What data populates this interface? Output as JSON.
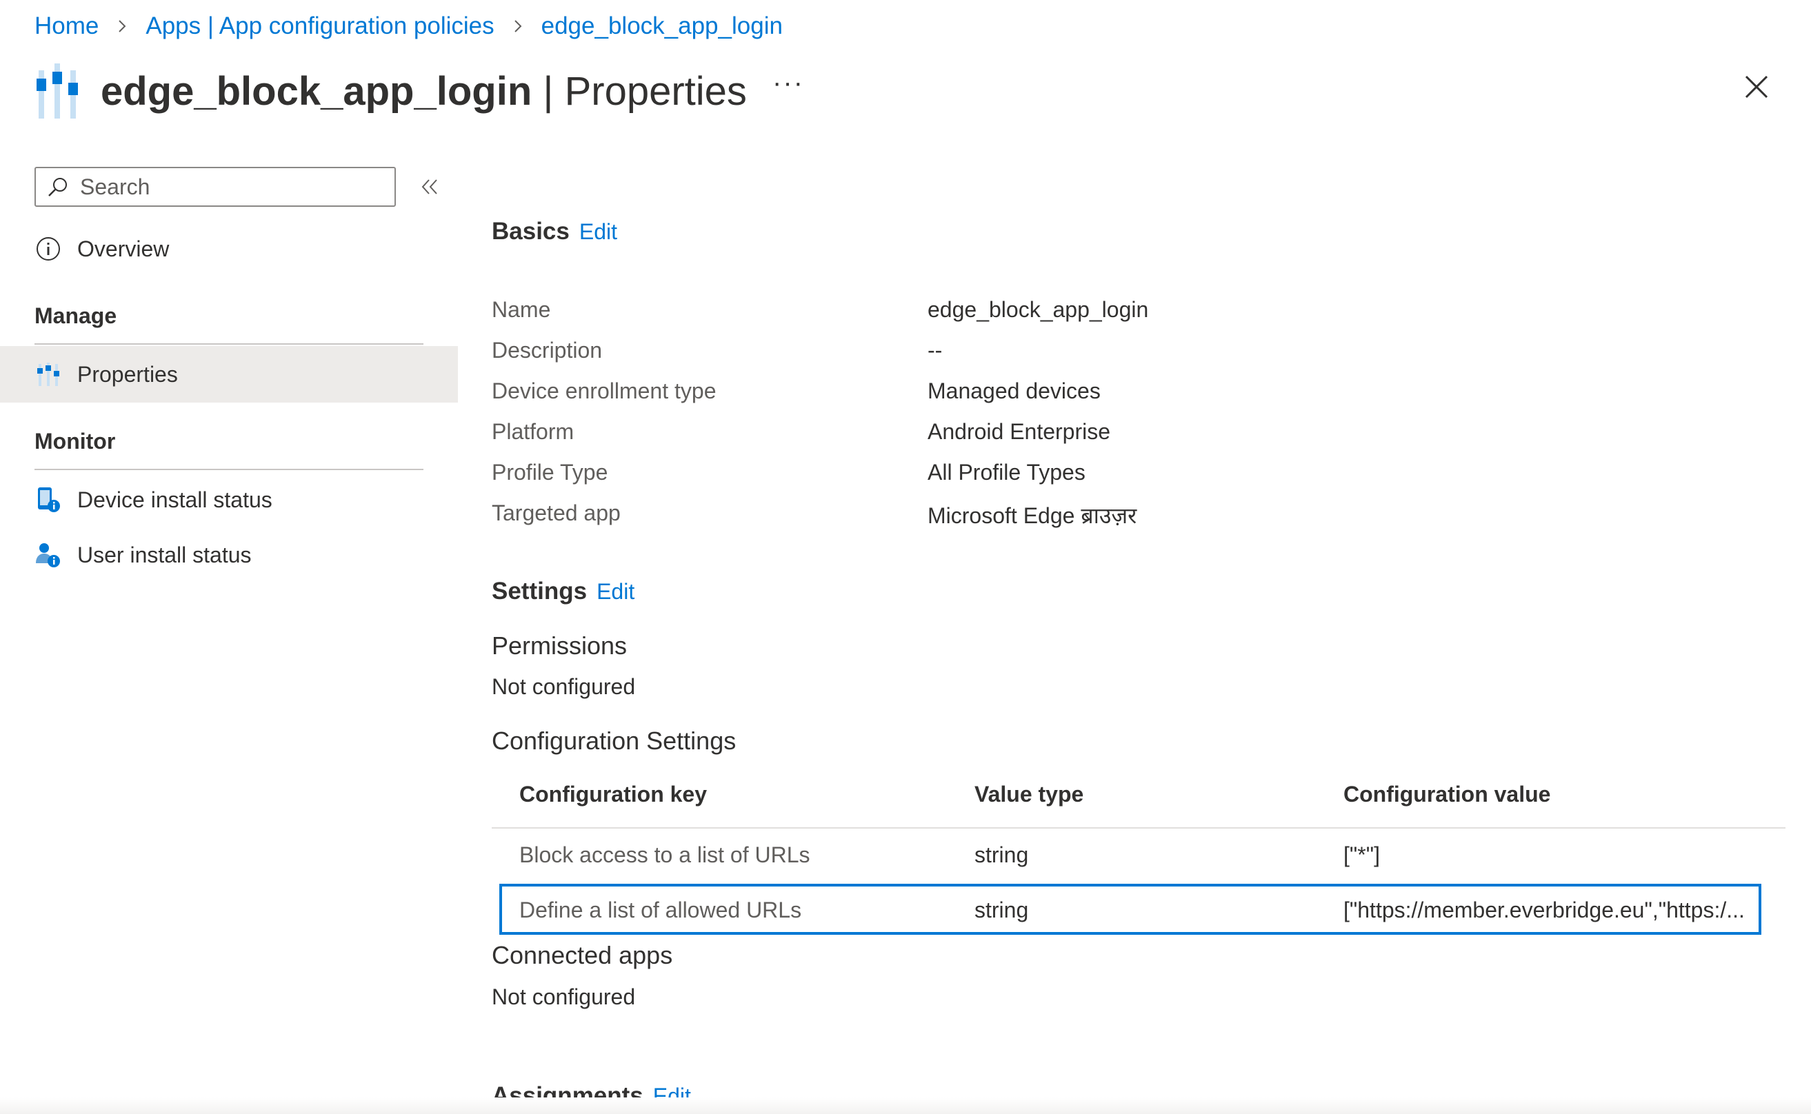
{
  "breadcrumb": {
    "items": [
      "Home",
      "Apps | App configuration policies",
      "edge_block_app_login"
    ]
  },
  "header": {
    "title_name": "edge_block_app_login",
    "title_suffix": "| Properties",
    "more_label": "···",
    "icon": "properties-sliders-icon"
  },
  "sidebar": {
    "search_placeholder": "Search",
    "overview_label": "Overview",
    "manage_label": "Manage",
    "properties_label": "Properties",
    "monitor_label": "Monitor",
    "device_install_label": "Device install status",
    "user_install_label": "User install status"
  },
  "basics": {
    "heading": "Basics",
    "edit_label": "Edit",
    "rows": [
      {
        "label": "Name",
        "value": "edge_block_app_login"
      },
      {
        "label": "Description",
        "value": "--"
      },
      {
        "label": "Device enrollment type",
        "value": "Managed devices"
      },
      {
        "label": "Platform",
        "value": "Android Enterprise"
      },
      {
        "label": "Profile Type",
        "value": "All Profile Types"
      },
      {
        "label": "Targeted app",
        "value": "Microsoft Edge ब्राउज़र"
      }
    ]
  },
  "settings": {
    "heading": "Settings",
    "edit_label": "Edit",
    "permissions_heading": "Permissions",
    "permissions_value": "Not configured",
    "config_heading": "Configuration Settings",
    "table": {
      "columns": [
        "Configuration key",
        "Value type",
        "Configuration value"
      ],
      "rows": [
        {
          "key": "Block access to a list of URLs",
          "type": "string",
          "value": "[\"*\"]"
        },
        {
          "key": "Define a list of allowed URLs",
          "type": "string",
          "value": "[\"https://member.everbridge.eu\",\"https:/..."
        }
      ]
    },
    "connected_heading": "Connected apps",
    "connected_value": "Not configured"
  },
  "assignments": {
    "heading": "Assignments",
    "edit_label": "Edit"
  },
  "colors": {
    "link": "#0078d4",
    "selected_bg": "#edebe9",
    "selected_border": "#0078d4"
  }
}
